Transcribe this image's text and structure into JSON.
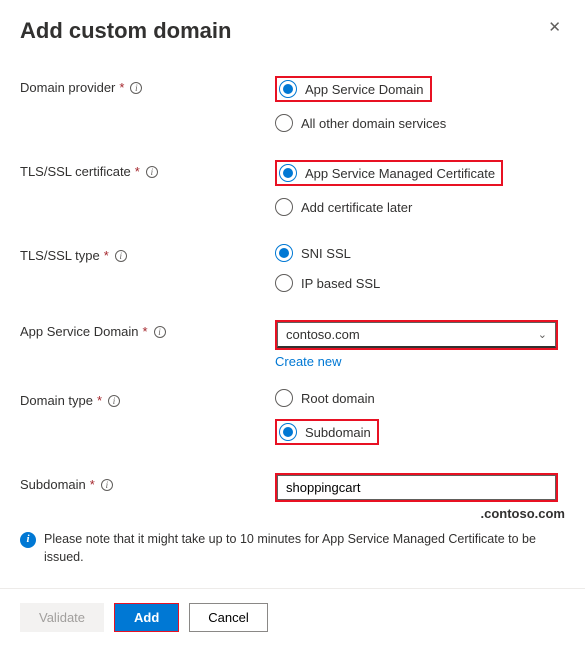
{
  "header": {
    "title": "Add custom domain"
  },
  "fields": {
    "domainProvider": {
      "label": "Domain provider",
      "options": {
        "appService": "App Service Domain",
        "other": "All other domain services"
      }
    },
    "tlsCert": {
      "label": "TLS/SSL certificate",
      "options": {
        "managed": "App Service Managed Certificate",
        "later": "Add certificate later"
      }
    },
    "tlsType": {
      "label": "TLS/SSL type",
      "options": {
        "sni": "SNI SSL",
        "ip": "IP based SSL"
      }
    },
    "appServiceDomain": {
      "label": "App Service Domain",
      "value": "contoso.com",
      "createNew": "Create new"
    },
    "domainType": {
      "label": "Domain type",
      "options": {
        "root": "Root domain",
        "sub": "Subdomain"
      }
    },
    "subdomain": {
      "label": "Subdomain",
      "value": "shoppingcart",
      "suffix": ".contoso.com"
    }
  },
  "note": "Please note that it might take up to 10 minutes for App Service Managed Certificate to be issued.",
  "footer": {
    "validate": "Validate",
    "add": "Add",
    "cancel": "Cancel"
  }
}
